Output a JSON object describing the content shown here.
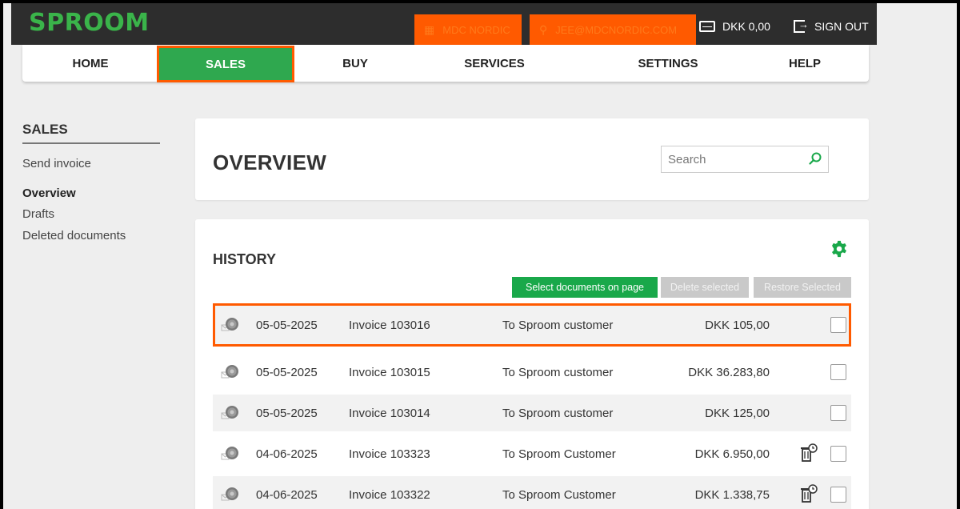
{
  "topbar": {
    "logo": "SPROOM",
    "company": "MDC NORDIC",
    "user": "JEE@MDCNORDIC.COM",
    "balance": "DKK 0,00",
    "signout": "SIGN OUT"
  },
  "nav": {
    "items": [
      {
        "label": "HOME"
      },
      {
        "label": "SALES"
      },
      {
        "label": "BUY"
      },
      {
        "label": "SERVICES"
      },
      {
        "label": "SETTINGS"
      },
      {
        "label": "HELP"
      }
    ]
  },
  "sidebar": {
    "title": "SALES",
    "items": [
      {
        "label": "Send invoice"
      },
      {
        "label": "Overview"
      },
      {
        "label": "Drafts"
      },
      {
        "label": "Deleted documents"
      }
    ]
  },
  "overview": {
    "title": "OVERVIEW",
    "search_placeholder": "Search"
  },
  "history": {
    "title": "HISTORY",
    "buttons": {
      "select": "Select documents on page",
      "delete": "Delete selected",
      "restore": "Restore Selected"
    },
    "rows": [
      {
        "date": "05-05-2025",
        "invoice": "Invoice 103016",
        "to": "To Sproom customer",
        "amount": "DKK 105,00",
        "trash": false
      },
      {
        "date": "05-05-2025",
        "invoice": "Invoice 103015",
        "to": "To Sproom customer",
        "amount": "DKK 36.283,80",
        "trash": false
      },
      {
        "date": "05-05-2025",
        "invoice": "Invoice 103014",
        "to": "To Sproom customer",
        "amount": "DKK 125,00",
        "trash": false
      },
      {
        "date": "04-06-2025",
        "invoice": "Invoice 103323",
        "to": "To Sproom Customer",
        "amount": "DKK 6.950,00",
        "trash": true
      },
      {
        "date": "04-06-2025",
        "invoice": "Invoice 103322",
        "to": "To Sproom Customer",
        "amount": "DKK 1.338,75",
        "trash": true
      }
    ]
  },
  "colors": {
    "brand_green": "#3ab44a",
    "highlight_orange": "#ff5a00",
    "topbar_bg": "#2d2d2d"
  }
}
